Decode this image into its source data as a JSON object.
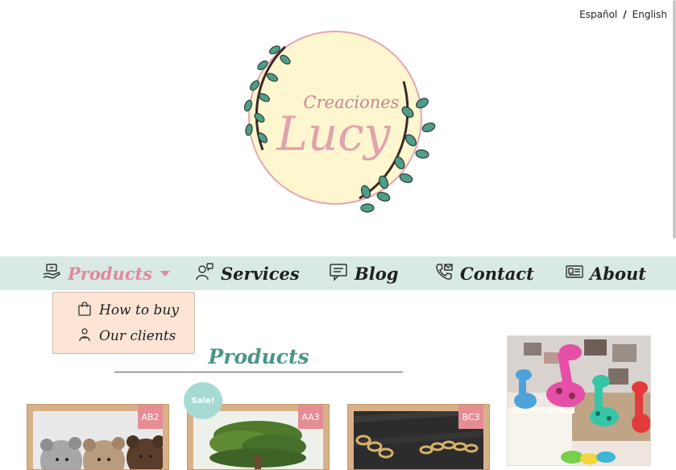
{
  "language": {
    "options": [
      "Español",
      "English"
    ],
    "separator": "/"
  },
  "logo": {
    "text_top": "Creaciones",
    "text_main": "Lucy"
  },
  "nav": {
    "items": [
      {
        "label": "Products",
        "icon": "products-hand-icon"
      },
      {
        "label": "Services",
        "icon": "services-person-icon"
      },
      {
        "label": "Blog",
        "icon": "blog-chat-icon"
      },
      {
        "label": "Contact",
        "icon": "contact-phone-icon"
      },
      {
        "label": "About",
        "icon": "about-card-icon"
      }
    ],
    "dropdown": [
      {
        "label": "How to buy",
        "icon": "shopping-bag-icon"
      },
      {
        "label": "Our clients",
        "icon": "clients-icon"
      }
    ]
  },
  "section": {
    "title": "Products"
  },
  "products": [
    {
      "code": "AB2",
      "image": "crochet-bears",
      "sale": false
    },
    {
      "code": "AA3",
      "image": "bonsai-tree",
      "sale": true,
      "sale_label": "Sale!"
    },
    {
      "code": "BC3",
      "image": "gold-bracelet",
      "sale": false
    }
  ],
  "sidebar_image": "plush-giraffes",
  "colors": {
    "nav_bg": "#d9e9e6",
    "accent_pink": "#e0899a",
    "title_teal": "#4a9688",
    "dropdown_bg": "#fde5d6",
    "card_frame": "#d9b189",
    "badge": "#e58d95",
    "sale_badge": "#a6dbd3"
  }
}
